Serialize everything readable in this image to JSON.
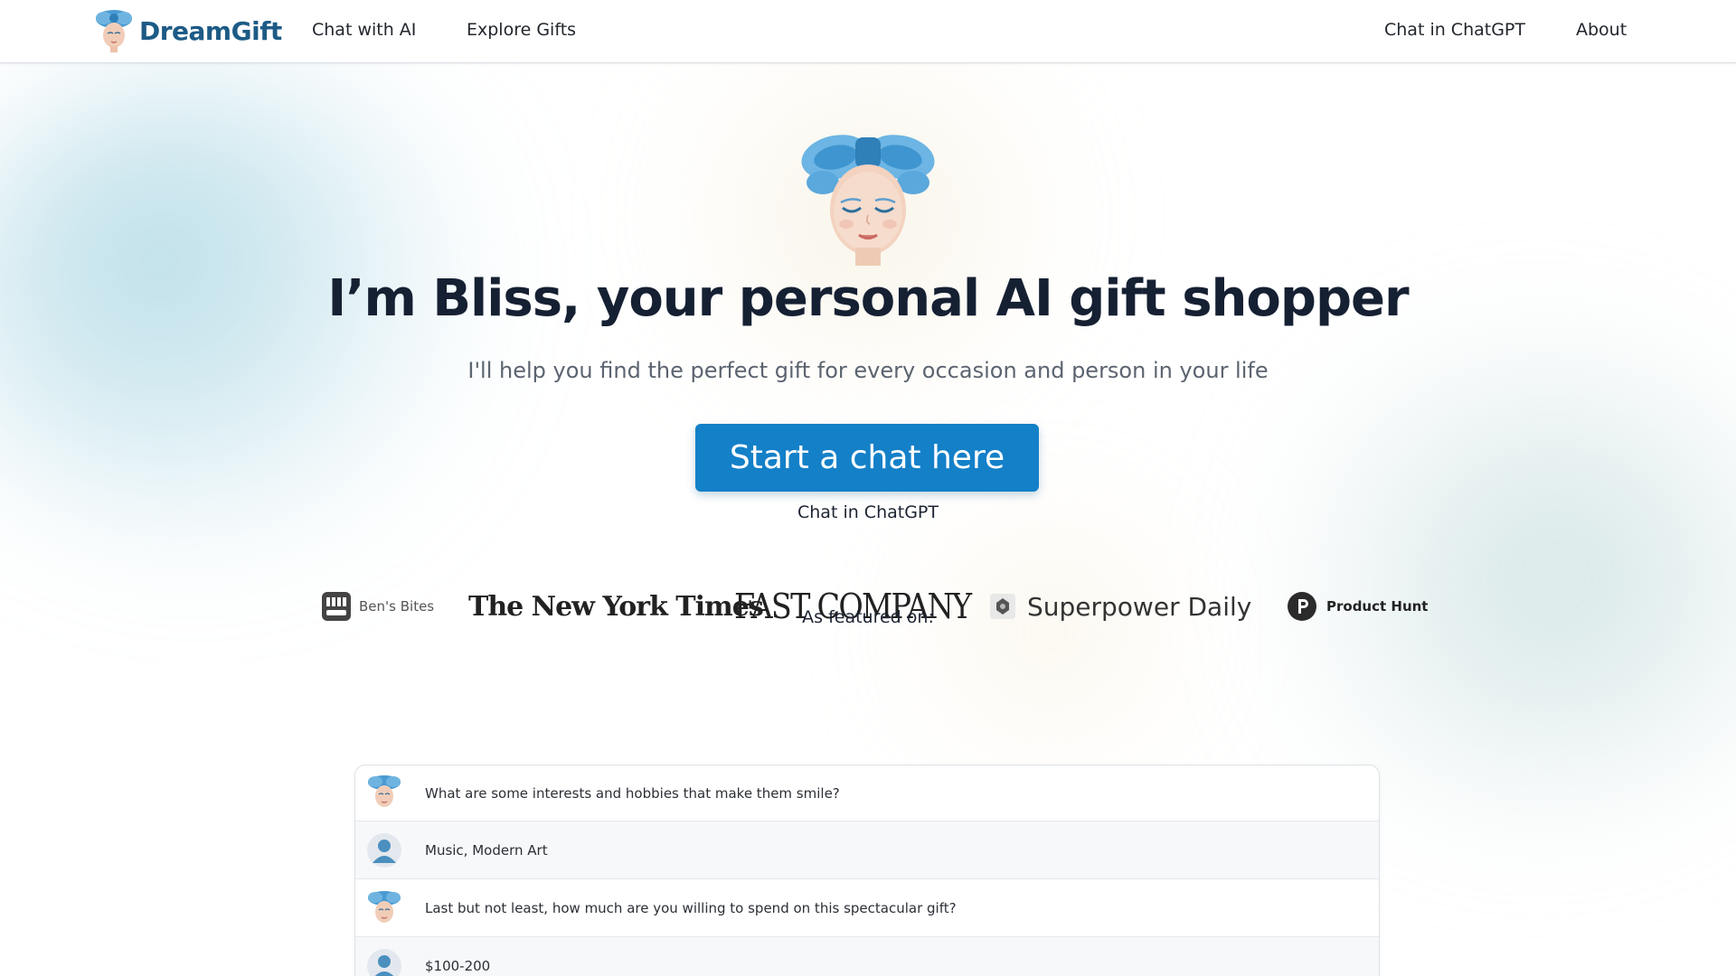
{
  "header": {
    "brand": "DreamGift",
    "nav_left": [
      "Chat with AI",
      "Explore Gifts"
    ],
    "nav_right": [
      "Chat in ChatGPT",
      "About"
    ]
  },
  "hero": {
    "title": "I’m Bliss, your personal AI gift shopper",
    "subtitle": "I'll help you find the perfect gift for every occasion and person in your life",
    "cta_label": "Start a chat here",
    "cta_secondary": "Chat in ChatGPT"
  },
  "featured": {
    "label": "As featured on:",
    "outlets": [
      {
        "name": "Ben's Bites",
        "icon": "bens-bites-logo-icon"
      },
      {
        "name": "The New York Times",
        "icon": "nyt-wordmark"
      },
      {
        "name": "FAST COMPANY",
        "icon": "fast-company-wordmark"
      },
      {
        "name": "Superpower Daily",
        "icon": "superpower-daily-logo-icon"
      },
      {
        "name": "Product Hunt",
        "icon": "product-hunt-logo-icon"
      }
    ]
  },
  "chat_preview": {
    "messages": [
      {
        "role": "assistant",
        "text": "What are some interests and hobbies that make them smile?"
      },
      {
        "role": "user",
        "text": "Music, Modern Art"
      },
      {
        "role": "assistant",
        "text": "Last but not least, how much are you willing to spend on this spectacular gift?"
      },
      {
        "role": "user",
        "text": "$100-200"
      }
    ]
  },
  "colors": {
    "brand": "#1d5b86",
    "cta": "#1480c8",
    "title": "#162033",
    "bow": "#3f95cf"
  }
}
